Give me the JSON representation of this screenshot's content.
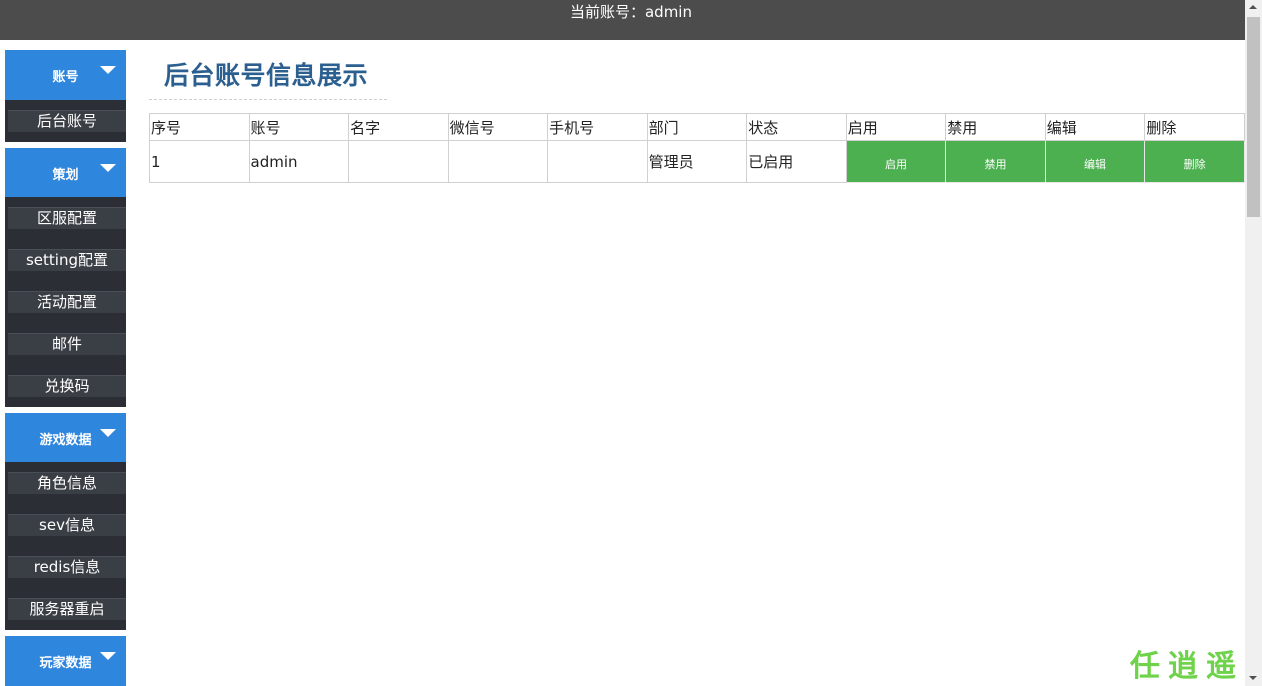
{
  "header": {
    "current_account": "当前账号：admin"
  },
  "sidebar": {
    "groups": [
      {
        "label": "账号",
        "items": [
          "后台账号"
        ]
      },
      {
        "label": "策划",
        "items": [
          "区服配置",
          "setting配置",
          "活动配置",
          "邮件",
          "兑换码"
        ]
      },
      {
        "label": "游戏数据",
        "items": [
          "角色信息",
          "sev信息",
          "redis信息",
          "服务器重启"
        ]
      },
      {
        "label": "玩家数据",
        "items": []
      }
    ]
  },
  "main": {
    "title": "后台账号信息展示",
    "table": {
      "columns": [
        "序号",
        "账号",
        "名字",
        "微信号",
        "手机号",
        "部门",
        "状态",
        "启用",
        "禁用",
        "编辑",
        "删除"
      ],
      "rows": [
        {
          "index": "1",
          "account": "admin",
          "name": "",
          "wechat": "",
          "phone": "",
          "department": "管理员",
          "status": "已启用",
          "enable": "启用",
          "disable": "禁用",
          "edit": "编辑",
          "delete": "删除"
        }
      ]
    }
  },
  "watermark": "任逍遥",
  "icons": {
    "group_toggle": "caret-down-icon"
  }
}
